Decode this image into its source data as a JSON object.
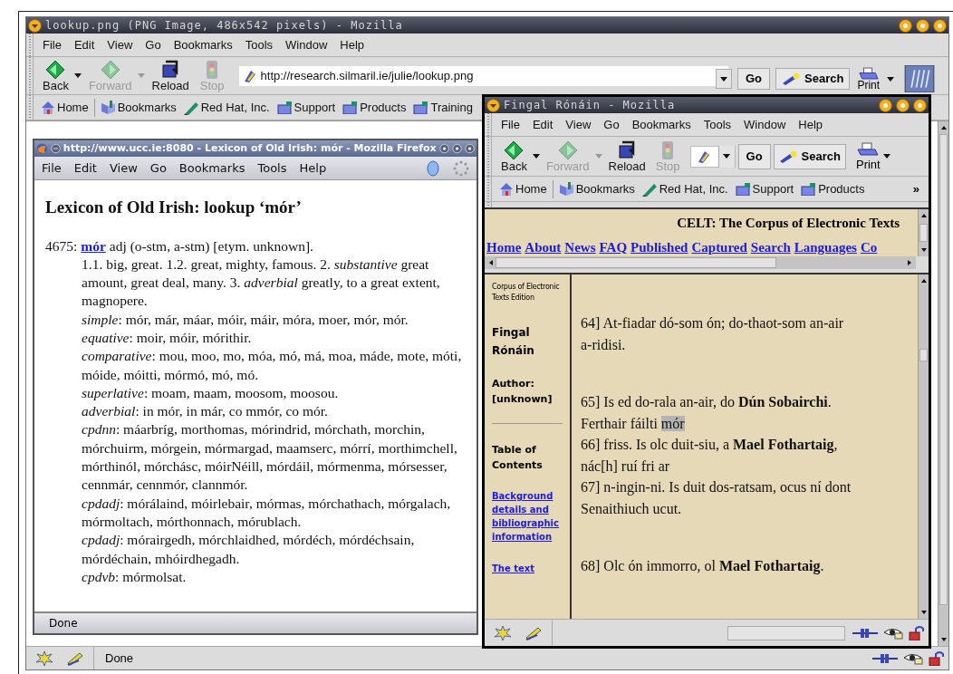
{
  "outer_window": {
    "title": "lookup.png (PNG Image, 486x542 pixels) - Mozilla",
    "menu": [
      "File",
      "Edit",
      "View",
      "Go",
      "Bookmarks",
      "Tools",
      "Window",
      "Help"
    ],
    "nav_buttons": [
      {
        "kind": "back",
        "label": "Back",
        "disabled": false
      },
      {
        "kind": "forward",
        "label": "Forward",
        "disabled": true
      },
      {
        "kind": "reload",
        "label": "Reload",
        "disabled": false
      },
      {
        "kind": "stop",
        "label": "Stop",
        "disabled": true
      }
    ],
    "address": "http://research.silmaril.ie/julie/lookup.png",
    "go": "Go",
    "search": "Search",
    "print": "Print",
    "bookmarks": [
      {
        "kind": "home",
        "label": "Home"
      },
      {
        "kind": "bookmarks",
        "label": "Bookmarks"
      },
      {
        "kind": "redhat",
        "label": "Red Hat, Inc."
      },
      {
        "kind": "folder",
        "label": "Support"
      },
      {
        "kind": "folder",
        "label": "Products"
      },
      {
        "kind": "folder",
        "label": "Training"
      }
    ],
    "status": "Done"
  },
  "firefox_window": {
    "title": "http://www.ucc.ie:8080 - Lexicon of Old Irish: mór - Mozilla Firefox",
    "menu": [
      "File",
      "Edit",
      "View",
      "Go",
      "Bookmarks",
      "Tools",
      "Help"
    ],
    "heading": "Lexicon of Old Irish: lookup ‘mór’",
    "entry_number": "4675:",
    "headword": "mór",
    "grammar": "adj (o-stm, a-stm) [etym. unknown].",
    "senses": "1.1. big, great. 1.2. great, mighty, famous. 2. *substantive* great amount, great deal, many. 3. *adverbial* greatly, to a great extent, magnopere.",
    "forms": [
      "*simple*: mór, már, máar, móir, máir, móra, moer, mór, mór.",
      "*equative*: moir, móir, mórithir.",
      "*comparative*: mou, moo, mo, móa, mó, má, moa, máde, mote, móti, móide, móitti, mórmó, mó, mó.",
      "*superlative*: moam, maam, moosom, moosou.",
      "*adverbial*: in mór, in már, co mmór, co mór.",
      "*cpdnn*: máarbríg, morthomas, mórindrid, mórchath, morchin, mórchuirm, mórgein, mórmargad, maamserc, mórrí, morthimchell, mórthinól, mórchásc, móirNéill, mórdáil, mórmenma, mórsesser, cennmár, cennmór, clannmór.",
      "*cpdadj*: mórálaind, móirlebair, mórmas, mórchathach, mórgalach, mórmoltach, mórthonnach, mórublach.",
      "*cpdadj*: mórairgedh, mórchlaidhed, mórdéch, mórdéchsain, mórdéchain, mhóirdhegadh.",
      "*cpdvb*: mórmolsat."
    ],
    "status": "Done"
  },
  "fingal_window": {
    "title": "Fingal Rónáin - Mozilla",
    "menu": [
      "File",
      "Edit",
      "View",
      "Go",
      "Bookmarks",
      "Tools",
      "Window",
      "Help"
    ],
    "nav_buttons": [
      {
        "kind": "back",
        "label": "Back",
        "disabled": false
      },
      {
        "kind": "forward",
        "label": "Forward",
        "disabled": true
      },
      {
        "kind": "reload",
        "label": "Reload",
        "disabled": false
      },
      {
        "kind": "stop",
        "label": "Stop",
        "disabled": true
      }
    ],
    "go": "Go",
    "search": "Search",
    "print": "Print",
    "bookmarks": [
      {
        "kind": "home",
        "label": "Home"
      },
      {
        "kind": "bookmarks",
        "label": "Bookmarks"
      },
      {
        "kind": "redhat",
        "label": "Red Hat, Inc."
      },
      {
        "kind": "folder",
        "label": "Support"
      },
      {
        "kind": "folder",
        "label": "Products"
      }
    ],
    "more": "»",
    "site_title": "CELT: The Corpus of Electronic Texts",
    "site_nav": [
      "Home",
      "About",
      "News",
      "FAQ",
      "Published",
      "Captured",
      "Search",
      "Languages",
      "Co"
    ],
    "sidebar": {
      "edition": "Corpus of Electronic Texts Edition",
      "work": "Fingal Rónáin",
      "author": "Author: [unknown]",
      "toc": "Table of Contents",
      "links": [
        "Background details and bibliographic information",
        "The text"
      ]
    },
    "text_blocks": [
      [
        {
          "text": "64] At-fiadar dó-som ón; do-thaot-som an-air"
        },
        {
          "text": "a-ridisi."
        }
      ],
      [
        {
          "text": "65] Is ed do-rala an-air, do **Dún Sobairchi**."
        },
        {
          "text": "Ferthair fáilti",
          "highlight": "mór"
        },
        {
          "text": "66] friss. Is olc duit-siu, a **Mael Fothartaig**,"
        },
        {
          "text": "nác[h] ruí fri ar"
        },
        {
          "text": "67] n-ingin-ni. Is duit dos-ratsam, ocus ní dont"
        },
        {
          "text": "Senaithiuch ucut."
        }
      ],
      [
        {
          "text": "68] Olc ón immorro, ol **Mael Fothartaig**."
        }
      ]
    ]
  }
}
